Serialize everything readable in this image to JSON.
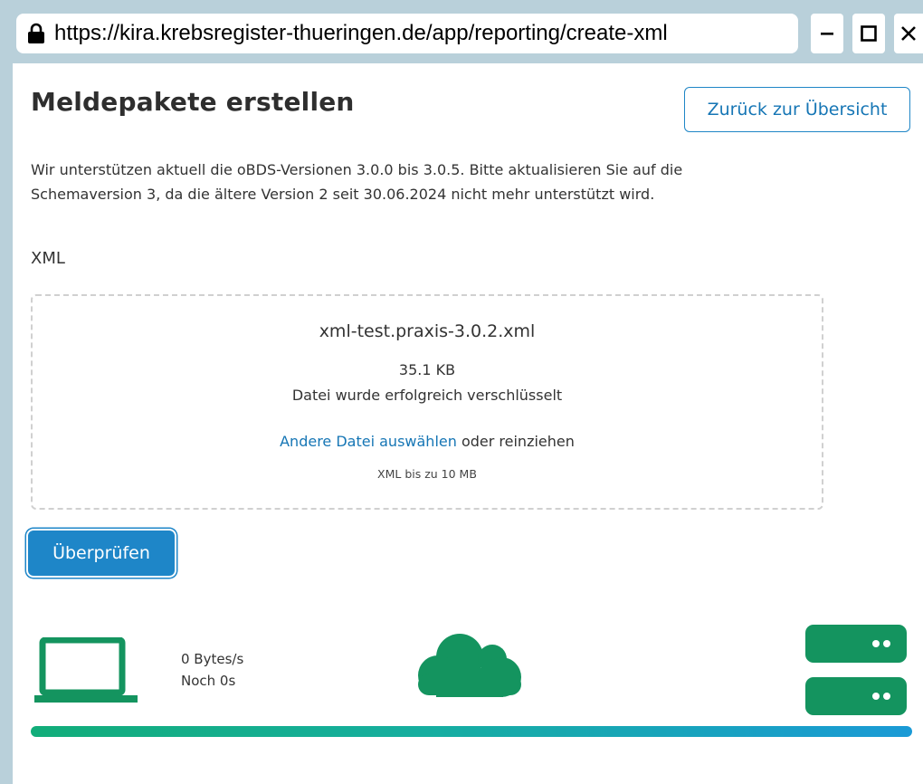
{
  "browser": {
    "url": "https://kira.krebsregister-thueringen.de/app/reporting/create-xml"
  },
  "header": {
    "title": "Meldepakete erstellen",
    "back_label": "Zurück zur Übersicht"
  },
  "info": {
    "line1": "Wir unterstützen aktuell die oBDS-Versionen 3.0.0 bis 3.0.5. Bitte aktualisieren Sie auf die",
    "line2": "Schemaversion 3, da die ältere Version 2 seit 30.06.2024 nicht mehr unterstützt wird."
  },
  "upload": {
    "section_label": "XML",
    "filename": "xml-test.praxis-3.0.2.xml",
    "size": "35.1 KB",
    "status": "Datei wurde erfolgreich verschlüsselt",
    "choose_link": "Andere Datei auswählen",
    "choose_suffix": " oder reinziehen",
    "limit": "XML bis zu 10 MB"
  },
  "actions": {
    "check_label": "Überprüfen"
  },
  "transfer": {
    "rate": "0 Bytes/s",
    "remaining": "Noch 0s",
    "progress": 1.0
  },
  "icons": {
    "lock": "lock-icon",
    "laptop": "laptop-icon",
    "cloud": "cloud-icon",
    "server": "server-icon"
  },
  "colors": {
    "accent": "#1e86c8",
    "green": "#14945f",
    "chrome": "#b9d0da"
  }
}
